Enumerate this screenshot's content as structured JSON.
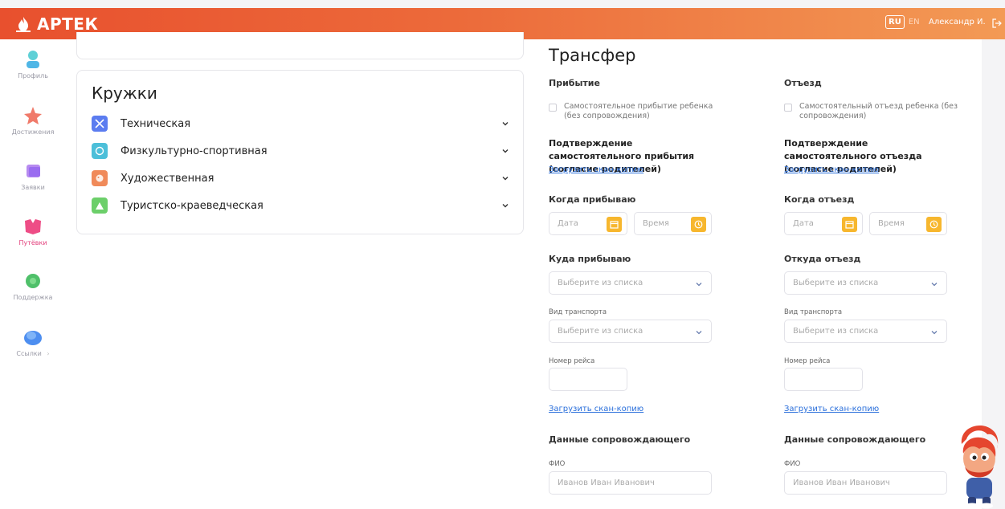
{
  "header": {
    "logo_text": "АРТЕК",
    "lang_active": "RU",
    "lang_other": "EN",
    "user_name": "Александр И."
  },
  "sidebar": {
    "items": [
      {
        "label": "Профиль",
        "icon": "profile-icon",
        "active": false
      },
      {
        "label": "Достижения",
        "icon": "achievements-icon",
        "active": false
      },
      {
        "label": "Заявки",
        "icon": "applications-icon",
        "active": false
      },
      {
        "label": "Путёвки",
        "icon": "vouchers-icon",
        "active": true
      },
      {
        "label": "Поддержка",
        "icon": "support-icon",
        "active": false
      },
      {
        "label": "Ссылки",
        "icon": "links-icon",
        "active": false
      }
    ]
  },
  "clubs": {
    "title": "Кружки",
    "items": [
      {
        "label": "Техническая",
        "color": "#5b7cf0",
        "icon": "technical-icon"
      },
      {
        "label": "Физкультурно-спортивная",
        "color": "#4cbfd9",
        "icon": "sport-icon"
      },
      {
        "label": "Художественная",
        "color": "#f08a5a",
        "icon": "art-icon"
      },
      {
        "label": "Туристско-краеведческая",
        "color": "#6ccf6a",
        "icon": "tourism-icon"
      }
    ]
  },
  "transfer": {
    "title": "Трансфер",
    "arrival": {
      "heading": "Прибытие",
      "checkbox_label": "Самостоятельное прибытие ребенка (без сопровождения)",
      "confirm_title": "Подтверждение самостоятельного прибытия (согласие родителей)",
      "upload_link": "Загрузить скан-копию",
      "when_title": "Когда прибываю",
      "date_placeholder": "Дата",
      "time_placeholder": "Время",
      "where_title": "Куда прибываю",
      "where_placeholder": "Выберите из списка",
      "transport_label": "Вид транспорта",
      "transport_placeholder": "Выберите из списка",
      "flight_label": "Номер рейса",
      "upload_link2": "Загрузить скан-копию",
      "escort_title": "Данные сопровождающего",
      "fio_label": "ФИО",
      "fio_placeholder": "Иванов Иван Иванович"
    },
    "departure": {
      "heading": "Отъезд",
      "checkbox_label": "Самостоятельный отъезд ребенка (без сопровождения)",
      "confirm_title": "Подтверждение самостоятельного отъезда (согласие родителей)",
      "upload_link": "Загрузить скан-копию",
      "when_title": "Когда отъезд",
      "date_placeholder": "Дата",
      "time_placeholder": "Время",
      "where_title": "Откуда отъезд",
      "where_placeholder": "Выберите из списка",
      "transport_label": "Вид транспорта",
      "transport_placeholder": "Выберите из списка",
      "flight_label": "Номер рейса",
      "upload_link2": "Загрузить скан-копию",
      "escort_title": "Данные сопровождающего",
      "fio_label": "ФИО",
      "fio_placeholder": "Иванов Иван Иванович"
    }
  },
  "colors": {
    "brand_orange": "#e8502e",
    "accent_yellow": "#f7b72e",
    "link_blue": "#2a6fdb",
    "active_pink": "#e23d7a"
  }
}
